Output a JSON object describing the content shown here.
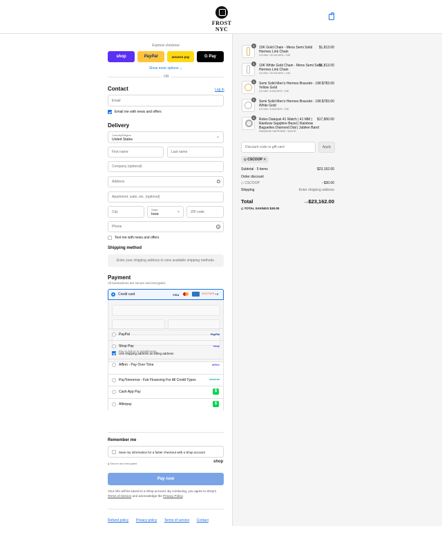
{
  "header": {
    "brand": "FROST NYC",
    "cart_icon": "bag-icon"
  },
  "express": {
    "title": "Express checkout",
    "buttons": [
      {
        "label": "shop",
        "bg": "#5a31f4",
        "fg": "#ffffff"
      },
      {
        "label": "PayPal",
        "bg": "#ffc439",
        "fg": "#003087"
      },
      {
        "label": "amazon pay",
        "bg": "#ffd814",
        "fg": "#111111"
      },
      {
        "label": "G Pay",
        "bg": "#000000",
        "fg": "#ffffff"
      }
    ],
    "more": "Show more options",
    "or": "OR"
  },
  "contact": {
    "title": "Contact",
    "login": "Log in",
    "email_placeholder": "Email",
    "news": "Email me with news and offers"
  },
  "delivery": {
    "title": "Delivery",
    "country_label": "Country/Region",
    "country_value": "United States",
    "first": "First name",
    "last": "Last name",
    "company": "Company (optional)",
    "address": "Address",
    "apt": "Apartment, suite, etc. (optional)",
    "city": "City",
    "state_label": "State",
    "state_value": "Iowa",
    "zip": "ZIP code",
    "phone": "Phone",
    "text_offers": "Text me with news and offers"
  },
  "shipping": {
    "title": "Shipping method",
    "note": "Enter your shipping address to view available shipping methods."
  },
  "payment": {
    "title": "Payment",
    "subtitle": "All transactions are secure and encrypted.",
    "credit": "Credit card",
    "card_more": "+4",
    "billing": "Use shipping address as billing address",
    "methods": [
      {
        "label": "PayPal",
        "logo": "PayPal"
      },
      {
        "label": "Shop Pay",
        "sub": "Pay in full or in installments",
        "logo": "shop"
      },
      {
        "label": "Affirm - Pay Over Time",
        "logo": "affirm"
      },
      {
        "label": "PayTomorrow - Fair Financing For All Credit Types",
        "logo": "tomorrow"
      },
      {
        "label": "Cash App Pay",
        "logo": "$"
      },
      {
        "label": "Afterpay",
        "logo": "$"
      }
    ]
  },
  "remember": {
    "title": "Remember me",
    "save": "Save my information for a faster checkout with a Shop account",
    "secure": "Secure and encrypted",
    "shop": "shop"
  },
  "paynow": "Pay now",
  "legal": {
    "line1": "Your info will be saved to a Shop account. By continuing, you agree to Shop's",
    "tos": "Terms of Service",
    "and": "and acknowledge the",
    "privacy": "Privacy Policy",
    "dot": "."
  },
  "footer": [
    "Refund policy",
    "Privacy policy",
    "Terms of service",
    "Contact"
  ],
  "cart": {
    "items": [
      {
        "qty": "1",
        "name": "10K Gold Chain - Mens Semi Solid Hermes Link Chain",
        "sub": "3.5 MM / 20 INCHES / 10K",
        "price": "$1,813.00"
      },
      {
        "qty": "1",
        "name": "10K White Gold Chain - Mens Semi Solid Hermes Link Chain",
        "sub": "3.5 MM / 20 INCHES / 10K",
        "price": "$1,813.00"
      },
      {
        "qty": "1",
        "name": "Semi Solid Men's Hermes Bracelet - 10K Yellow Gold",
        "sub": "3.5 MM / 8 INCHES / 10K",
        "price": "$783.00"
      },
      {
        "qty": "1",
        "name": "Semi Solid Men's Hermes Bracelet - 10K White Gold",
        "sub": "3.5 MM / 8 INCHES / 10K",
        "price": "$783.00"
      },
      {
        "qty": "1",
        "name": "Rolex Datejust 41 Watch | 41 MM | Rainbow Sapphire Bezel | Rainbow Baguettes Diamond Dial | Jubilee Band",
        "sub": "RAINBOW SAPPHIRE / WHITE",
        "price": "$17,800.00"
      }
    ],
    "discount_placeholder": "Discount code or gift card",
    "apply": "Apply",
    "code": "CSCOOP",
    "subtotal_label": "Subtotal · 5 items",
    "subtotal": "$23,192.00",
    "order_discount": "Order discount",
    "code2": "CSCOOP",
    "discount_amount": "- $30.00",
    "shipping_label": "Shipping",
    "shipping_value": "Enter shipping address",
    "total_label": "Total",
    "currency": "USD",
    "total": "$23,162.00",
    "savings_label": "TOTAL SAVINGS",
    "savings": "$30.00"
  }
}
